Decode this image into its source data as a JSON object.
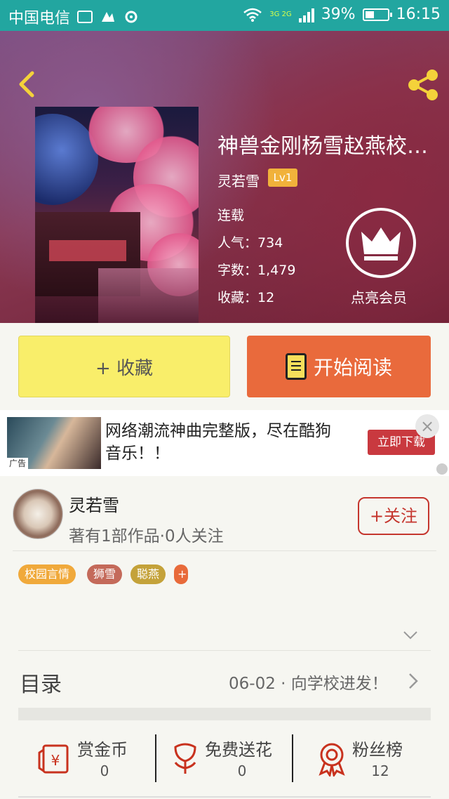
{
  "status_bar": {
    "carrier": "中国电信",
    "network": "3G 2G",
    "battery": "39%",
    "time": "16:15"
  },
  "book": {
    "title": "神兽金刚杨雪赵燕校…",
    "author": "灵若雪",
    "level": "Lv1",
    "status": "连载",
    "popularity_label": "人气：",
    "popularity": "734",
    "words_label": "字数：",
    "words": "1,479",
    "favorites_label": "收藏：",
    "favorites": "12"
  },
  "vip": {
    "label": "点亮会员"
  },
  "actions": {
    "favorite": "+ 收藏",
    "read": "开始阅读"
  },
  "ad": {
    "tag": "广告",
    "text": "网络潮流神曲完整版，尽在酷狗音乐！！",
    "button": "立即下载",
    "close": "×"
  },
  "author_card": {
    "name": "灵若雪",
    "subtitle": "著有1部作品·0人关注",
    "follow": "+关注"
  },
  "tags": [
    {
      "label": "校园言情",
      "color": "#f0a93b"
    },
    {
      "label": "狮雪",
      "color": "#c46a5a"
    },
    {
      "label": "聪燕",
      "color": "#c4a23a"
    },
    {
      "label": "+",
      "color": "#e86a3a"
    }
  ],
  "catalog": {
    "label": "目录",
    "latest": "06-02 · 向学校进发！"
  },
  "stats": [
    {
      "label": "赏金币",
      "value": "0"
    },
    {
      "label": "免费送花",
      "value": "0"
    },
    {
      "label": "粉丝榜",
      "value": "12"
    }
  ],
  "colors": {
    "status_bar": "#22a6a0",
    "favorite_button": "#f9ee6a",
    "read_button": "#e96a3c",
    "follow_red": "#c5362e",
    "icon_red": "#c8321e",
    "level_badge": "#f1b23b"
  }
}
